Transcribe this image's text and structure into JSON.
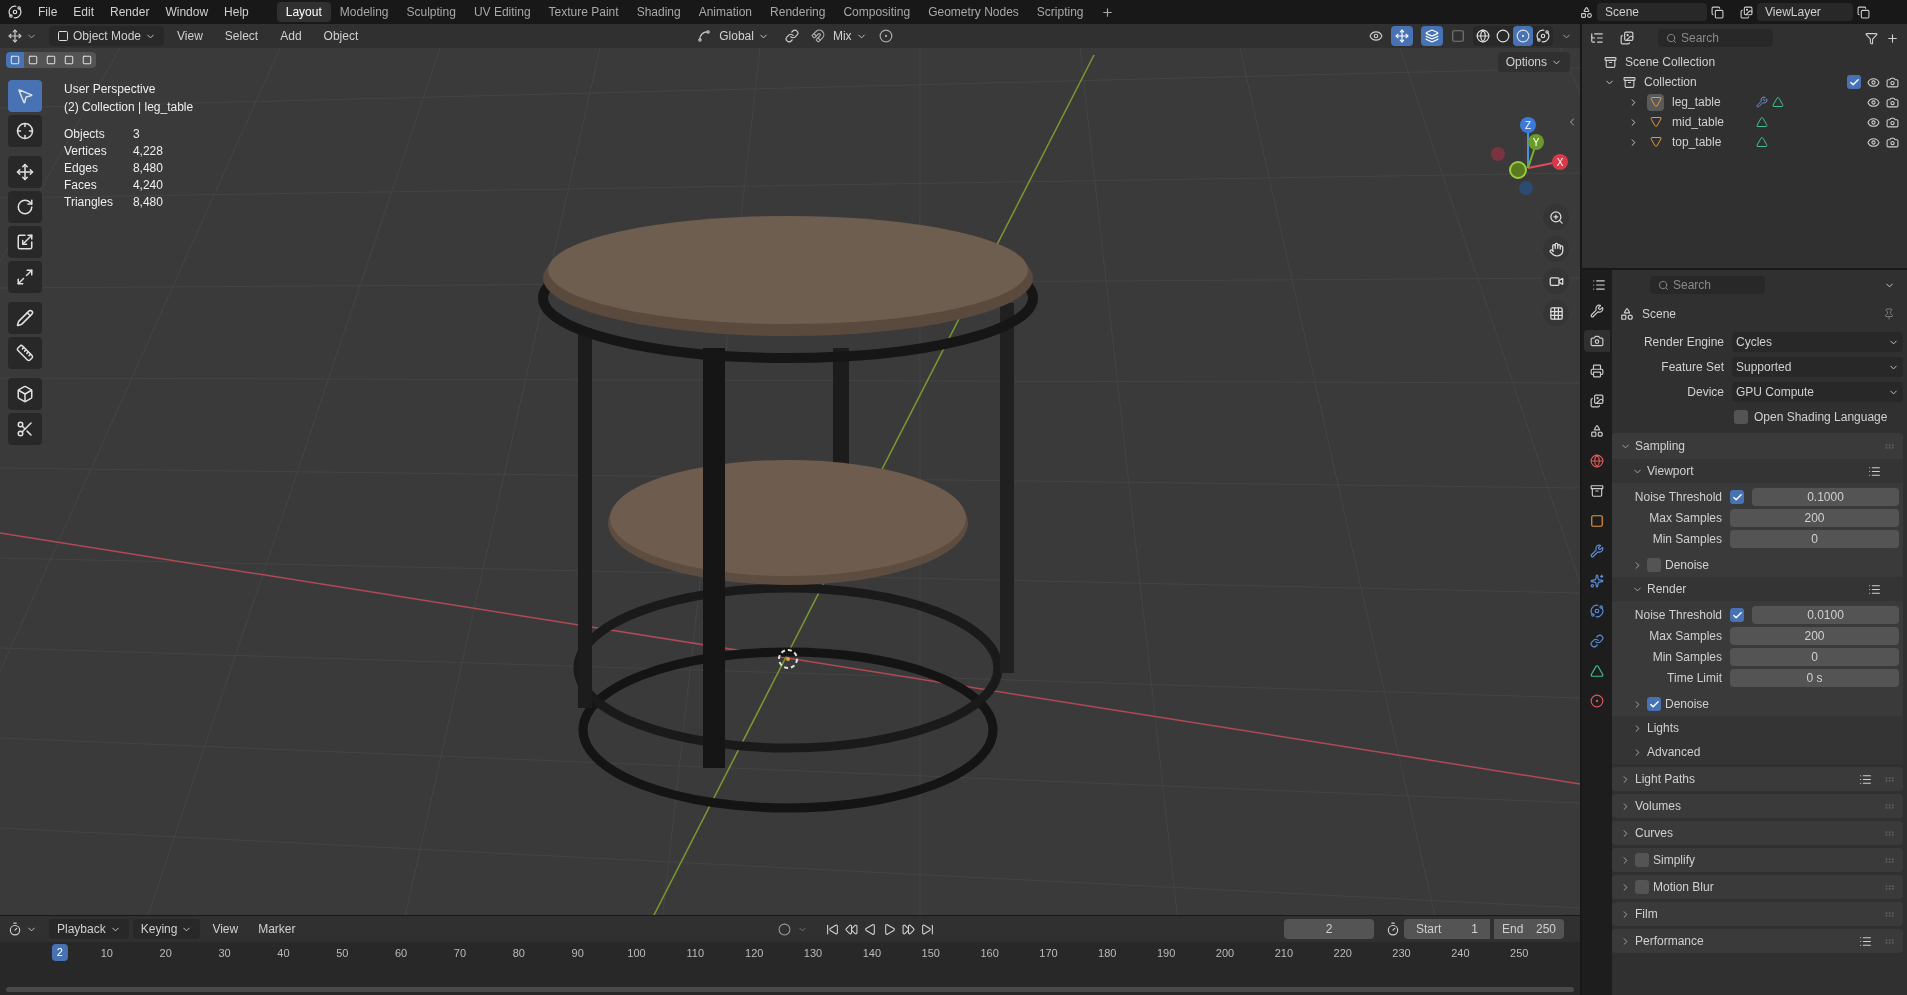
{
  "top_bar": {
    "menus": [
      "File",
      "Edit",
      "Render",
      "Window",
      "Help"
    ],
    "workspaces": [
      {
        "label": "Layout",
        "selected": true
      },
      {
        "label": "Modeling",
        "selected": false
      },
      {
        "label": "Sculpting",
        "selected": false
      },
      {
        "label": "UV Editing",
        "selected": false
      },
      {
        "label": "Texture Paint",
        "selected": false
      },
      {
        "label": "Shading",
        "selected": false
      },
      {
        "label": "Animation",
        "selected": false
      },
      {
        "label": "Rendering",
        "selected": false
      },
      {
        "label": "Compositing",
        "selected": false
      },
      {
        "label": "Geometry Nodes",
        "selected": false
      },
      {
        "label": "Scripting",
        "selected": false
      }
    ],
    "scene": "Scene",
    "view_layer": "ViewLayer"
  },
  "viewport": {
    "header": {
      "mode": "Object Mode",
      "menus": [
        "View",
        "Select",
        "Add",
        "Object"
      ],
      "orientation": "Global",
      "blend": "Mix"
    },
    "shading_modes": [
      {
        "kind": "wireframe",
        "selected": false
      },
      {
        "kind": "solid",
        "selected": false
      },
      {
        "kind": "material",
        "selected": true
      },
      {
        "kind": "rendered",
        "selected": false
      }
    ],
    "options": "Options",
    "select_modes": [
      {
        "selected": true
      },
      {
        "selected": false
      },
      {
        "selected": false
      },
      {
        "selected": false
      },
      {
        "selected": false
      }
    ],
    "tools": [
      {
        "kind": "select",
        "selected": true
      },
      {
        "kind": "cursor",
        "selected": false
      },
      {
        "kind": "move",
        "selected": false
      },
      {
        "kind": "rotate",
        "selected": false
      },
      {
        "kind": "scale",
        "selected": false
      },
      {
        "kind": "transform",
        "selected": false
      },
      {
        "kind": "annotate",
        "selected": false
      },
      {
        "kind": "measure",
        "selected": false
      },
      {
        "kind": "add-cube",
        "selected": false
      },
      {
        "kind": "cut",
        "selected": false
      }
    ],
    "info": {
      "view": "User Perspective",
      "context": "(2) Collection | leg_table"
    },
    "stats": [
      {
        "label": "Objects",
        "value": "3"
      },
      {
        "label": "Vertices",
        "value": "4,228"
      },
      {
        "label": "Edges",
        "value": "8,480"
      },
      {
        "label": "Faces",
        "value": "4,240"
      },
      {
        "label": "Triangles",
        "value": "8,480"
      }
    ],
    "gizmo_axes": [
      "Z",
      "Y",
      "X"
    ]
  },
  "outliner": {
    "search": {
      "placeholder": "Search"
    },
    "root": "Scene Collection",
    "collection": {
      "name": "Collection",
      "expanded": true,
      "checked": true,
      "children": [
        {
          "name": "leg_table",
          "selected": true,
          "modifier": true
        },
        {
          "name": "mid_table",
          "selected": false,
          "modifier": false
        },
        {
          "name": "top_table",
          "selected": false,
          "modifier": false
        }
      ]
    }
  },
  "properties": {
    "search": {
      "placeholder": "Search"
    },
    "tabs": [
      {
        "kind": "tool",
        "selected": false
      },
      {
        "kind": "render",
        "selected": true
      },
      {
        "kind": "output",
        "selected": false
      },
      {
        "kind": "view-layer",
        "selected": false
      },
      {
        "kind": "scene",
        "selected": false
      },
      {
        "kind": "world",
        "selected": false
      },
      {
        "kind": "collection",
        "selected": false
      },
      {
        "kind": "object",
        "selected": false
      },
      {
        "kind": "modifier",
        "selected": false
      },
      {
        "kind": "particles",
        "selected": false
      },
      {
        "kind": "physics",
        "selected": false
      },
      {
        "kind": "constraints",
        "selected": false
      },
      {
        "kind": "data",
        "selected": false
      },
      {
        "kind": "material",
        "selected": false
      }
    ],
    "context": "Scene",
    "fields": [
      {
        "label": "Render Engine",
        "value": "Cycles"
      },
      {
        "label": "Feature Set",
        "value": "Supported"
      },
      {
        "label": "Device",
        "value": "GPU Compute"
      }
    ],
    "osl": {
      "label": "Open Shading Language",
      "checked": false
    },
    "sampling": {
      "label": "Sampling",
      "expanded": true,
      "subpanels": [
        {
          "label": "Viewport",
          "expanded": true,
          "presets": true,
          "rows": [
            {
              "kind": "check-number",
              "label": "Noise Threshold",
              "checked": true,
              "value": "0.1000"
            },
            {
              "kind": "number",
              "label": "Max Samples",
              "value": "200"
            },
            {
              "kind": "number",
              "label": "Min Samples",
              "value": "0"
            }
          ],
          "denoise": {
            "label": "Denoise",
            "checked": false,
            "expanded": false
          }
        },
        {
          "label": "Render",
          "expanded": true,
          "presets": true,
          "rows": [
            {
              "kind": "check-number",
              "label": "Noise Threshold",
              "checked": true,
              "value": "0.0100"
            },
            {
              "kind": "number",
              "label": "Max Samples",
              "value": "200"
            },
            {
              "kind": "number",
              "label": "Min Samples",
              "value": "0"
            },
            {
              "kind": "number",
              "label": "Time Limit",
              "value": "0 s"
            }
          ],
          "denoise": {
            "label": "Denoise",
            "checked": true,
            "expanded": false
          }
        }
      ],
      "more": [
        {
          "label": "Lights",
          "expanded": false
        },
        {
          "label": "Advanced",
          "expanded": false
        }
      ]
    },
    "panels": [
      {
        "label": "Light Paths",
        "kind": "plain",
        "expanded": false,
        "presets": true
      },
      {
        "label": "Volumes",
        "kind": "plain",
        "expanded": false,
        "presets": false
      },
      {
        "label": "Curves",
        "kind": "plain",
        "expanded": false,
        "presets": false
      },
      {
        "label": "Simplify",
        "kind": "toggle",
        "checked": false,
        "expanded": false,
        "presets": false
      },
      {
        "label": "Motion Blur",
        "kind": "toggle",
        "checked": false,
        "expanded": false,
        "presets": false
      },
      {
        "label": "Film",
        "kind": "plain",
        "expanded": false,
        "presets": false
      },
      {
        "label": "Performance",
        "kind": "plain",
        "expanded": false,
        "presets": true
      }
    ]
  },
  "timeline": {
    "menus": [
      "Playback",
      "Keying",
      "View",
      "Marker"
    ],
    "current_frame": "2",
    "start": {
      "label": "Start",
      "value": "1"
    },
    "end": {
      "label": "End",
      "value": "250"
    },
    "playhead": "2",
    "ruler": [
      "10",
      "20",
      "30",
      "40",
      "50",
      "60",
      "70",
      "80",
      "90",
      "100",
      "110",
      "120",
      "130",
      "140",
      "150",
      "160",
      "170",
      "180",
      "190",
      "200",
      "210",
      "220",
      "230",
      "240",
      "250"
    ]
  }
}
